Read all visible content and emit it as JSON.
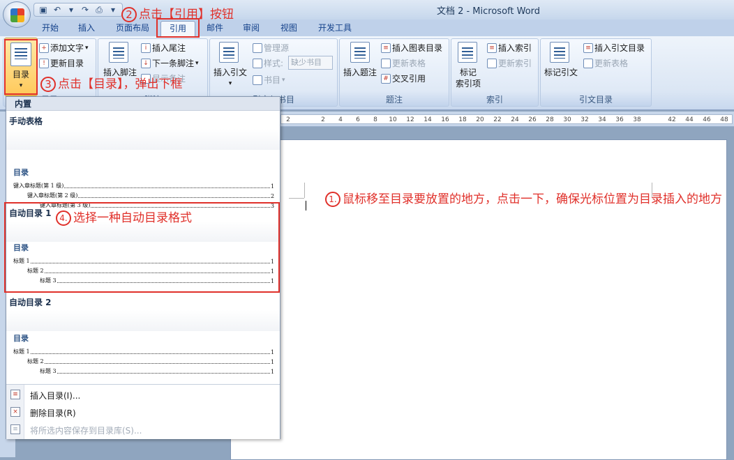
{
  "window": {
    "title": "文档 2 - Microsoft Word"
  },
  "tabs": [
    "开始",
    "插入",
    "页面布局",
    "引用",
    "邮件",
    "审阅",
    "视图",
    "开发工具"
  ],
  "active_tab": "引用",
  "ribbon": {
    "toc_group": {
      "toc": "目录",
      "add_text": "添加文字",
      "update_toc": "更新目录",
      "label": "目录"
    },
    "footnote_group": {
      "insert_footnote": "插入脚注",
      "insert_endnote": "插入尾注",
      "next_footnote": "下一条脚注",
      "show_notes": "显示备注",
      "label": "脚注"
    },
    "citation_group": {
      "insert_citation": "插入引文",
      "manage_sources": "管理源",
      "style": "样式:",
      "style_value": "缺少书目",
      "bibliography": "书目",
      "label": "引文与书目"
    },
    "caption_group": {
      "insert_caption": "插入题注",
      "insert_tof": "插入图表目录",
      "update_table": "更新表格",
      "cross_ref": "交叉引用",
      "label": "题注"
    },
    "index_group": {
      "mark_entry_1": "标记",
      "mark_entry_2": "索引项",
      "insert_index": "插入索引",
      "update_index": "更新索引",
      "label": "索引"
    },
    "toa_group": {
      "mark_citation": "标记引文",
      "insert_toa": "插入引文目录",
      "update_table": "更新表格",
      "label": "引文目录"
    }
  },
  "ruler": {
    "ticks": [
      "2",
      "2",
      "4",
      "6",
      "8",
      "10",
      "12",
      "14",
      "16",
      "18",
      "20",
      "22",
      "24",
      "26",
      "28",
      "30",
      "32",
      "34",
      "36",
      "38",
      "42",
      "44",
      "46",
      "48"
    ]
  },
  "dropdown": {
    "header": "内置",
    "manual": {
      "title": "手动表格",
      "heading": "目录",
      "lines": [
        {
          "text": "键入章标题(第 1 级)",
          "num": "1"
        },
        {
          "text": "键入章标题(第 2 级)",
          "num": "2"
        },
        {
          "text": "键入章标题(第 3 级)",
          "num": "3"
        }
      ]
    },
    "auto1": {
      "title": "自动目录 1",
      "heading": "目录",
      "lines": [
        {
          "text": "标题 1",
          "num": "1"
        },
        {
          "text": "标题 2",
          "num": "1"
        },
        {
          "text": "标题 3",
          "num": "1"
        }
      ]
    },
    "auto2": {
      "title": "自动目录 2",
      "heading": "目录",
      "lines": [
        {
          "text": "标题 1",
          "num": "1"
        },
        {
          "text": "标题 2",
          "num": "1"
        },
        {
          "text": "标题 3",
          "num": "1"
        }
      ]
    },
    "footer": {
      "insert_toc": "插入目录(I)...",
      "remove_toc": "删除目录(R)",
      "save_selection": "将所选内容保存到目录库(S)..."
    }
  },
  "annotations": {
    "step1": {
      "num": "1.",
      "text": "鼠标移至目录要放置的地方，点击一下，确保光标位置为目录插入的地方"
    },
    "step2": {
      "num": "2",
      "text": "点击【引用】按钮"
    },
    "step3": {
      "num": "3",
      "text": "点击【目录】，弹出下框"
    },
    "step4": {
      "num": "4.",
      "text": "选择一种自动目录格式"
    },
    "color": "#e0302a"
  }
}
